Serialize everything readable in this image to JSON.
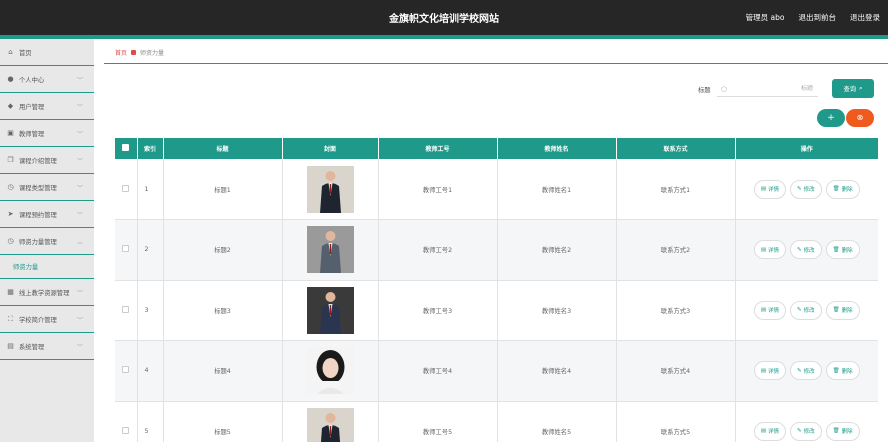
{
  "header": {
    "title": "金旗帜文化培训学校网站",
    "user_label": "管理员 abo",
    "front_label": "退出到前台",
    "logout_label": "退出登录"
  },
  "sidebar": {
    "items": [
      {
        "label": "首页",
        "icon": "home-icon",
        "glyph": "⌂",
        "has_chevron": false
      },
      {
        "label": "个人中心",
        "icon": "user-icon",
        "glyph": "●",
        "has_chevron": true
      },
      {
        "label": "用户管理",
        "icon": "location-icon",
        "glyph": "◆",
        "has_chevron": true
      },
      {
        "label": "教师管理",
        "icon": "briefcase-icon",
        "glyph": "▣",
        "has_chevron": true
      },
      {
        "label": "课程介绍管理",
        "icon": "copy-icon",
        "glyph": "❐",
        "has_chevron": true
      },
      {
        "label": "课程类型管理",
        "icon": "clock-icon",
        "glyph": "◷",
        "has_chevron": true
      },
      {
        "label": "课程预约管理",
        "icon": "send-icon",
        "glyph": "➤",
        "has_chevron": true
      },
      {
        "label": "师资力量管理",
        "icon": "clock-icon",
        "glyph": "◷",
        "has_chevron": true,
        "expanded": true
      }
    ],
    "sub_item": "师资力量",
    "items_after": [
      {
        "label": "线上教学资源管理",
        "icon": "grid-icon",
        "glyph": "▦",
        "has_chevron": true
      },
      {
        "label": "学校简介管理",
        "icon": "frame-icon",
        "glyph": "⛶",
        "has_chevron": true
      },
      {
        "label": "系统管理",
        "icon": "list-icon",
        "glyph": "▤",
        "has_chevron": true
      }
    ]
  },
  "breadcrumb": {
    "home": "首页",
    "current": "师资力量"
  },
  "search": {
    "label": "标题",
    "placeholder": "标题",
    "button_label": "查询"
  },
  "toolbar": {
    "add_label": "+",
    "delete_label": "⊗"
  },
  "table": {
    "columns": [
      "索引",
      "标题",
      "封面",
      "教师工号",
      "教师姓名",
      "联系方式",
      "操作"
    ],
    "rows": [
      {
        "index": "1",
        "title": "标题1",
        "cover": "man-suit-dark",
        "teacher_no": "教师工号1",
        "teacher_name": "教师姓名1",
        "contact": "联系方式1"
      },
      {
        "index": "2",
        "title": "标题2",
        "cover": "man-suit-grey",
        "teacher_no": "教师工号2",
        "teacher_name": "教师姓名2",
        "contact": "联系方式2"
      },
      {
        "index": "3",
        "title": "标题3",
        "cover": "man-sitting",
        "teacher_no": "教师工号3",
        "teacher_name": "教师姓名3",
        "contact": "联系方式3"
      },
      {
        "index": "4",
        "title": "标题4",
        "cover": "woman-portrait",
        "teacher_no": "教师工号4",
        "teacher_name": "教师姓名4",
        "contact": "联系方式4"
      },
      {
        "index": "5",
        "title": "标题5",
        "cover": "man-suit-dark",
        "teacher_no": "教师工号5",
        "teacher_name": "教师姓名5",
        "contact": "联系方式5"
      }
    ],
    "actions": {
      "detail": "详情",
      "edit": "修改",
      "delete": "删除"
    }
  },
  "colors": {
    "accent": "#1f9a8a",
    "danger": "#f05a1e",
    "header_bg": "#262626"
  }
}
